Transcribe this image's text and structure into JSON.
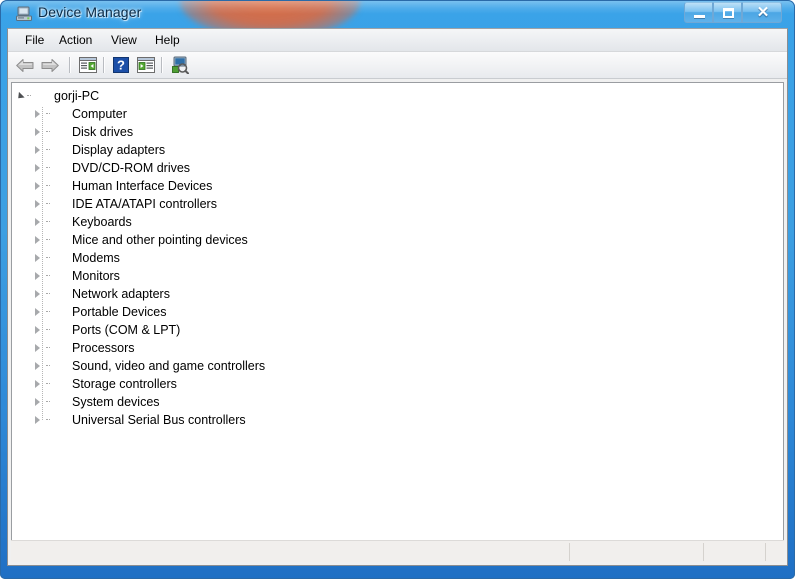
{
  "window": {
    "title": "Device Manager",
    "title_icon": "device-manager-icon",
    "controls": {
      "minimize_label": "–",
      "maximize_label": "□",
      "close_label": "✕"
    }
  },
  "menubar": {
    "items": [
      {
        "label": "File",
        "name": "menu-file"
      },
      {
        "label": "Action",
        "name": "menu-action"
      },
      {
        "label": "View",
        "name": "menu-view"
      },
      {
        "label": "Help",
        "name": "menu-help"
      }
    ]
  },
  "toolbar": {
    "buttons": [
      {
        "name": "back-arrow-icon",
        "tooltip": "Back"
      },
      {
        "name": "forward-arrow-icon",
        "tooltip": "Forward"
      },
      {
        "name": "show-hide-console-tree-icon",
        "tooltip": "Show/Hide Console Tree"
      },
      {
        "name": "help-icon",
        "tooltip": "Help",
        "glyph": "?"
      },
      {
        "name": "properties-icon",
        "tooltip": "Properties"
      },
      {
        "name": "scan-for-hardware-changes-icon",
        "tooltip": "Scan for hardware changes"
      }
    ]
  },
  "tree": {
    "root": {
      "label": "gorji-PC",
      "icon": "computer-root-icon",
      "expanded": true
    },
    "children": [
      {
        "label": "Computer",
        "icon": "computer-icon"
      },
      {
        "label": "Disk drives",
        "icon": "disk-drive-icon"
      },
      {
        "label": "Display adapters",
        "icon": "display-adapter-icon"
      },
      {
        "label": "DVD/CD-ROM drives",
        "icon": "dvd-drive-icon"
      },
      {
        "label": "Human Interface Devices",
        "icon": "hid-icon"
      },
      {
        "label": "IDE ATA/ATAPI controllers",
        "icon": "ide-controller-icon"
      },
      {
        "label": "Keyboards",
        "icon": "keyboard-icon"
      },
      {
        "label": "Mice and other pointing devices",
        "icon": "mouse-icon"
      },
      {
        "label": "Modems",
        "icon": "modem-icon"
      },
      {
        "label": "Monitors",
        "icon": "monitor-icon"
      },
      {
        "label": "Network adapters",
        "icon": "network-adapter-icon"
      },
      {
        "label": "Portable Devices",
        "icon": "portable-device-icon"
      },
      {
        "label": "Ports (COM & LPT)",
        "icon": "port-icon"
      },
      {
        "label": "Processors",
        "icon": "processor-icon"
      },
      {
        "label": "Sound, video and game controllers",
        "icon": "sound-controller-icon"
      },
      {
        "label": "Storage controllers",
        "icon": "storage-controller-icon"
      },
      {
        "label": "System devices",
        "icon": "system-device-icon"
      },
      {
        "label": "Universal Serial Bus controllers",
        "icon": "usb-controller-icon"
      }
    ]
  },
  "statusbar": {
    "panes": [
      {
        "text": ""
      },
      {
        "text": ""
      },
      {
        "text": ""
      }
    ]
  },
  "colors": {
    "titlebar_blue": "#3aa3e8",
    "wallpaper_accent": "#e26a3c",
    "client_bg": "#f0f0f0",
    "tree_bg": "#ffffff",
    "statusbar_bg": "#f1efed",
    "help_icon_blue": "#1c4fa8"
  }
}
